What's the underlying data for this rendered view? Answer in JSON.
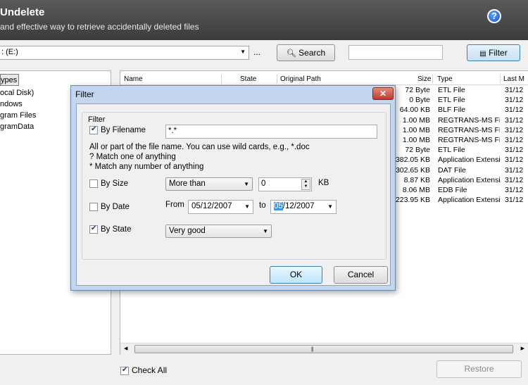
{
  "header": {
    "title": "Undelete",
    "subtitle": "and effective way to retrieve accidentally deleted files"
  },
  "toolbar": {
    "drive_value": ": (E:)",
    "browse_label": "...",
    "search_label": "Search",
    "search_value": "",
    "filter_label": "Filter"
  },
  "left_panel": {
    "tab_label": "ypes",
    "tree_items": [
      "ocal Disk)",
      "ndows",
      "gram Files",
      "gramData"
    ]
  },
  "file_list": {
    "columns": [
      "Name",
      "State",
      "Original Path",
      "Size",
      "Type",
      "Last M"
    ],
    "rows": [
      {
        "size": "72 Byte",
        "type": "ETL File",
        "last_modified": "31/12"
      },
      {
        "size": "0 Byte",
        "type": "ETL File",
        "last_modified": "31/12"
      },
      {
        "size": "64.00 KB",
        "type": "BLF File",
        "last_modified": "31/12"
      },
      {
        "size": "1.00 MB",
        "type": "REGTRANS-MS File",
        "last_modified": "31/12"
      },
      {
        "size": "1.00 MB",
        "type": "REGTRANS-MS File",
        "last_modified": "31/12"
      },
      {
        "size": "1.00 MB",
        "type": "REGTRANS-MS File",
        "last_modified": "31/12"
      },
      {
        "size": "72 Byte",
        "type": "ETL File",
        "last_modified": "31/12"
      },
      {
        "size": "382.05 KB",
        "type": "Application Extension",
        "last_modified": "31/12"
      },
      {
        "size": "302.65 KB",
        "type": "DAT File",
        "last_modified": "31/12"
      },
      {
        "size": "8.87 KB",
        "type": "Application Extension",
        "last_modified": "31/12"
      },
      {
        "size": "8.06 MB",
        "type": "EDB File",
        "last_modified": "31/12"
      },
      {
        "size": "223.95 KB",
        "type": "Application Extension",
        "last_modified": "31/12"
      }
    ]
  },
  "footer": {
    "check_all_label": "Check All",
    "check_all_checked": true,
    "restore_label": "Restore"
  },
  "dialog": {
    "title": "Filter",
    "close_glyph": "✕",
    "group_label": "Filter",
    "by_filename": {
      "label": "By Filename",
      "checked": true,
      "value": "*.*"
    },
    "hint_lines": [
      "All or part of the file name. You can use wild cards, e.g., *.doc",
      "? Match one of anything",
      "* Match any number of anything"
    ],
    "by_size": {
      "label": "By Size",
      "checked": false,
      "operator": "More than",
      "value": "0",
      "unit": "KB"
    },
    "by_date": {
      "label": "By Date",
      "checked": false,
      "from_label": "From",
      "from_value": "05/12/2007",
      "to_label": "to",
      "to_value_selected": "05",
      "to_value_rest": "/12/2007"
    },
    "by_state": {
      "label": "By State",
      "checked": true,
      "value": "Very good"
    },
    "ok_label": "OK",
    "cancel_label": "Cancel"
  }
}
